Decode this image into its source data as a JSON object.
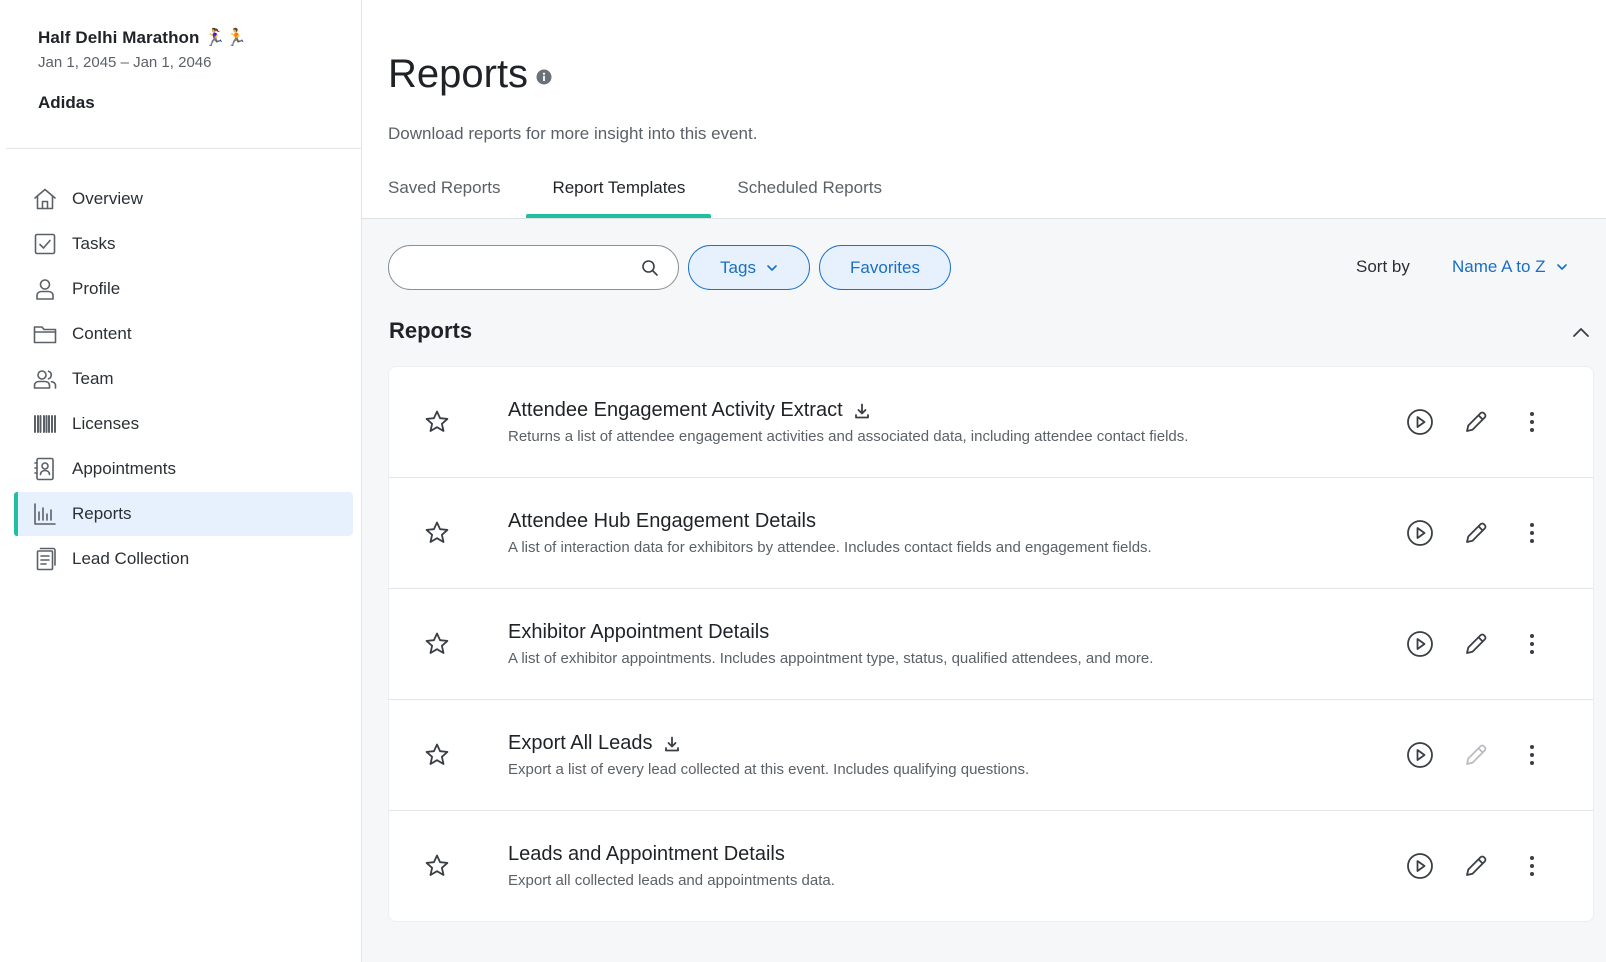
{
  "event": {
    "name": "Half Delhi Marathon 🏃‍♀️🏃",
    "dates": "Jan 1, 2045 – Jan 1, 2046",
    "org": "Adidas"
  },
  "sidebar": {
    "items": [
      {
        "label": "Overview",
        "icon": "home-icon"
      },
      {
        "label": "Tasks",
        "icon": "checkbox-icon"
      },
      {
        "label": "Profile",
        "icon": "person-icon"
      },
      {
        "label": "Content",
        "icon": "folder-icon"
      },
      {
        "label": "Team",
        "icon": "team-icon"
      },
      {
        "label": "Licenses",
        "icon": "barcode-icon"
      },
      {
        "label": "Appointments",
        "icon": "contact-card-icon"
      },
      {
        "label": "Reports",
        "icon": "bar-chart-icon",
        "active": true
      },
      {
        "label": "Lead Collection",
        "icon": "documents-icon"
      }
    ]
  },
  "page": {
    "title": "Reports",
    "subtitle": "Download reports for more insight into this event."
  },
  "tabs": [
    {
      "label": "Saved Reports"
    },
    {
      "label": "Report Templates",
      "active": true
    },
    {
      "label": "Scheduled Reports"
    }
  ],
  "toolbar": {
    "search_placeholder": "",
    "tags_label": "Tags",
    "favorites_label": "Favorites",
    "sort_label": "Sort by",
    "sort_value": "Name A to Z"
  },
  "section": {
    "title": "Reports"
  },
  "reports": [
    {
      "title": "Attendee Engagement Activity Extract",
      "desc": "Returns a list of attendee engagement activities and associated data, including attendee contact fields.",
      "download": true,
      "edit_disabled": false
    },
    {
      "title": "Attendee Hub Engagement Details",
      "desc": "A list of interaction data for exhibitors by attendee. Includes contact fields and engagement fields.",
      "download": false,
      "edit_disabled": false
    },
    {
      "title": "Exhibitor Appointment Details",
      "desc": "A list of exhibitor appointments. Includes appointment type, status, qualified attendees, and more.",
      "download": false,
      "edit_disabled": false
    },
    {
      "title": "Export All Leads",
      "desc": "Export a list of every lead collected at this event. Includes qualifying questions.",
      "download": true,
      "edit_disabled": true
    },
    {
      "title": "Leads and Appointment Details",
      "desc": "Export all collected leads and appointments data.",
      "download": false,
      "edit_disabled": false
    }
  ],
  "colors": {
    "accent": "#1fbf9f",
    "link": "#1a6fc4",
    "active_bg": "#e6f1fd"
  }
}
